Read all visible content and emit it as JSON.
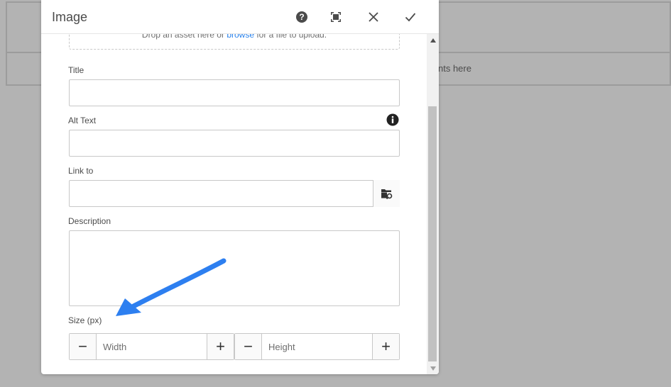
{
  "background": {
    "partial_text": "nts here"
  },
  "dialog": {
    "title": "Image",
    "header_buttons": [
      {
        "name": "help-icon"
      },
      {
        "name": "fullscreen-icon"
      },
      {
        "name": "close-icon"
      },
      {
        "name": "checkmark-icon"
      }
    ],
    "dropzone": {
      "text_before": "Drop an asset here or ",
      "link": "browse",
      "text_after": " for a file to upload."
    },
    "fields": {
      "title_label": "Title",
      "title_value": "",
      "alt_label": "Alt Text",
      "alt_value": "",
      "link_label": "Link to",
      "link_value": "",
      "description_label": "Description",
      "description_value": ""
    },
    "size": {
      "label": "Size (px)",
      "width_placeholder": "Width",
      "height_placeholder": "Height",
      "minus": "−",
      "plus": "+"
    }
  },
  "colors": {
    "accent": "#2680eb",
    "annotation_arrow": "#2d7ff0",
    "overlay": "#b3b3b3"
  }
}
